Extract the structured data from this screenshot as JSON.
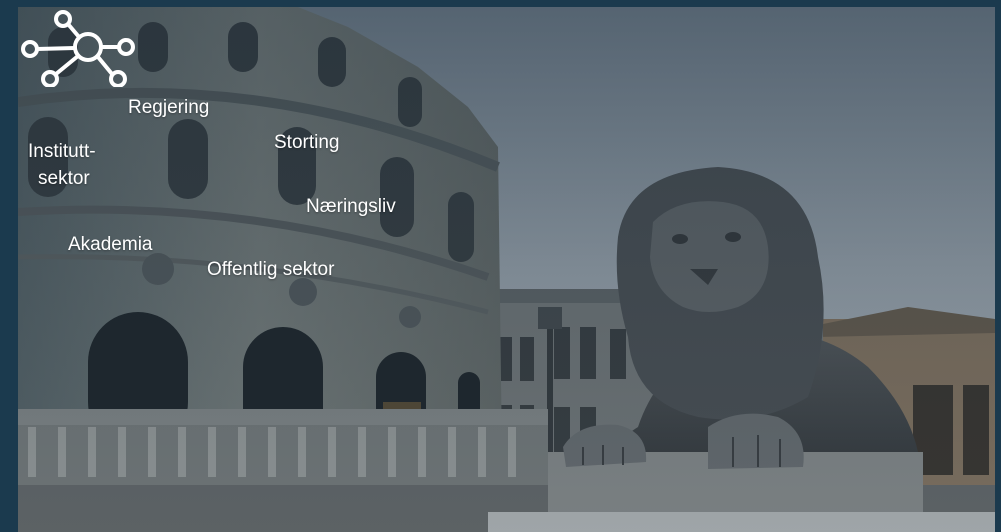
{
  "labels": {
    "regjering": "Regjering",
    "storting": "Storting",
    "instituttsektor_line1": "Institutt-",
    "instituttsektor_line2": "sektor",
    "naeringsliv": "Næringsliv",
    "akademia": "Akademia",
    "offentlig_sektor": "Offentlig sektor"
  },
  "icons": {
    "network": "network-hub-icon"
  },
  "colors": {
    "frame": "#1b3a4e",
    "text": "#ffffff"
  }
}
